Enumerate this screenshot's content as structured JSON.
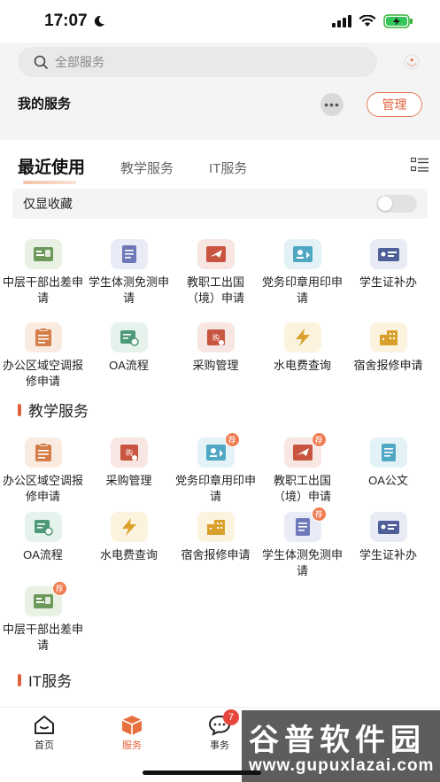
{
  "status_bar": {
    "time": "17:07"
  },
  "search": {
    "placeholder": "全部服务"
  },
  "header": {
    "my_services": "我的服务",
    "more": "•••",
    "manage": "管理"
  },
  "tabs": [
    {
      "label": "最近使用"
    },
    {
      "label": "教学服务"
    },
    {
      "label": "IT服务"
    }
  ],
  "filter": {
    "favorites_only": "仅显收藏",
    "enabled": false
  },
  "recent": [
    {
      "label": "中层干部出差申请",
      "icon": "id-card-icon",
      "color": "green"
    },
    {
      "label": "学生体测免测申请",
      "icon": "document-icon",
      "color": "blue"
    },
    {
      "label": "教职工出国（境）申请",
      "icon": "plane-icon",
      "color": "red"
    },
    {
      "label": "党务印章用印申请",
      "icon": "stamp-card-icon",
      "color": "cyan"
    },
    {
      "label": "学生证补办",
      "icon": "student-card-icon",
      "color": "navy"
    },
    {
      "label": "办公区域空调报修申请",
      "icon": "clipboard-icon",
      "color": "orange"
    },
    {
      "label": "OA流程",
      "icon": "flow-icon",
      "color": "teal"
    },
    {
      "label": "采购管理",
      "icon": "purchase-icon",
      "color": "red"
    },
    {
      "label": "水电费查询",
      "icon": "lightning-icon",
      "color": "yellow"
    },
    {
      "label": "宿舍报修申请",
      "icon": "building-icon",
      "color": "yellow"
    }
  ],
  "teaching_section": {
    "title": "教学服务",
    "items": [
      {
        "label": "办公区域空调报修申请",
        "icon": "clipboard-icon",
        "color": "orange",
        "badge": ""
      },
      {
        "label": "采购管理",
        "icon": "purchase-icon",
        "color": "red",
        "badge": ""
      },
      {
        "label": "党务印章用印申请",
        "icon": "stamp-card-icon",
        "color": "cyan",
        "badge": "荐"
      },
      {
        "label": "教职工出国（境）申请",
        "icon": "plane-icon",
        "color": "red",
        "badge": "荐"
      },
      {
        "label": "OA公文",
        "icon": "document-icon",
        "color": "cyan",
        "badge": ""
      },
      {
        "label": "OA流程",
        "icon": "flow-icon",
        "color": "teal",
        "badge": ""
      },
      {
        "label": "水电费查询",
        "icon": "lightning-icon",
        "color": "yellow",
        "badge": ""
      },
      {
        "label": "宿舍报修申请",
        "icon": "building-icon",
        "color": "yellow",
        "badge": ""
      },
      {
        "label": "学生体测免测申请",
        "icon": "document-icon",
        "color": "blue",
        "badge": "荐"
      },
      {
        "label": "学生证补办",
        "icon": "student-card-icon",
        "color": "navy",
        "badge": ""
      },
      {
        "label": "中层干部出差申请",
        "icon": "id-card-icon",
        "color": "green",
        "badge": "荐"
      }
    ]
  },
  "it_section": {
    "title": "IT服务"
  },
  "tab_bar": {
    "home": "首页",
    "services": "服务",
    "tasks": "事务",
    "tasks_badge": "7"
  },
  "watermark": {
    "title": "谷普软件园",
    "url": "www.gupuxlazai.com"
  },
  "colors": {
    "accent": "#e0623d",
    "green": "#6d9a5a",
    "blue": "#6e78b8",
    "red": "#c8553f",
    "cyan": "#4fa7c4",
    "navy": "#4f5f9a",
    "orange": "#d57d47",
    "teal": "#4c9a78",
    "yellow": "#d9a12b"
  }
}
